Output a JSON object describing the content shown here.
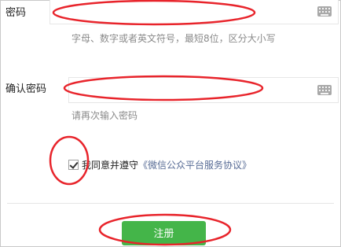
{
  "form": {
    "password": {
      "label": "密码",
      "value": "",
      "hint": "字母、数字或者英文符号，最短8位，区分大小写",
      "keyboard_icon": "keyboard-icon"
    },
    "confirm_password": {
      "label": "确认密码",
      "value": "",
      "hint": "请再次输入密码",
      "keyboard_icon": "keyboard-icon"
    },
    "agreement": {
      "checked": true,
      "text": "我同意并遵守",
      "link_text": "《微信公众平台服务协议》"
    },
    "submit_label": "注册"
  },
  "colors": {
    "submit_button": "#44b549",
    "link": "#576b95",
    "annotation_red": "#e8242b"
  }
}
